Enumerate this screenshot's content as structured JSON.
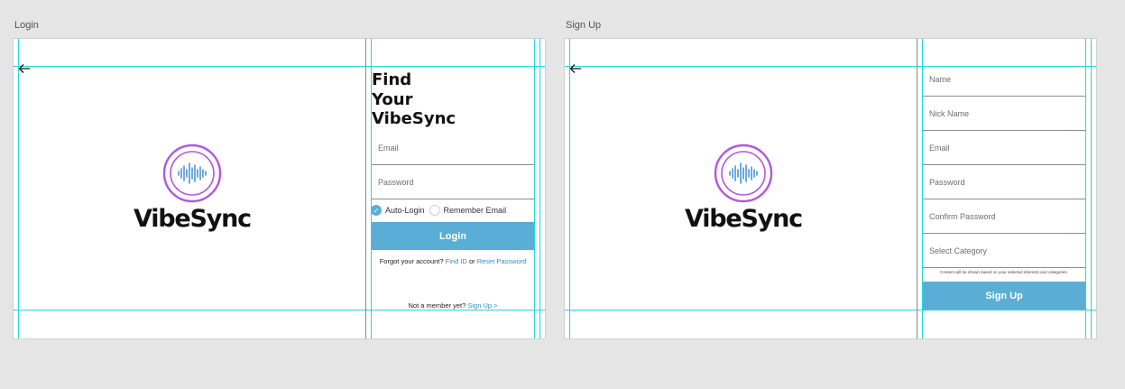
{
  "brand": {
    "name": "VibeSync",
    "ring_color": "#b156e0",
    "wave_color": "#4a95d4"
  },
  "accent": "#5aaed6",
  "link_color": "#2b8fd0",
  "guide_color": "#1fd8e0",
  "login": {
    "label": "Login",
    "heading": [
      "Find",
      "Your",
      "VibeSync"
    ],
    "email_placeholder": "Email",
    "password_placeholder": "Password",
    "auto_login": "Auto-Login",
    "remember_email": "Remember Email",
    "button": "Login",
    "forgot_text": "Forgot your account?",
    "find_id": "Find ID",
    "or_text": "or",
    "reset_password": "Reset Password",
    "member_text": "Not a member yet?",
    "signup_link": "Sign Up >"
  },
  "signup": {
    "label": "Sign Up",
    "fields": [
      "Name",
      "Nick Name",
      "Email",
      "Password",
      "Confirm Password",
      "Select Category"
    ],
    "note": "Content will be shown based on your selected interests and categories.",
    "button": "Sign Up"
  }
}
